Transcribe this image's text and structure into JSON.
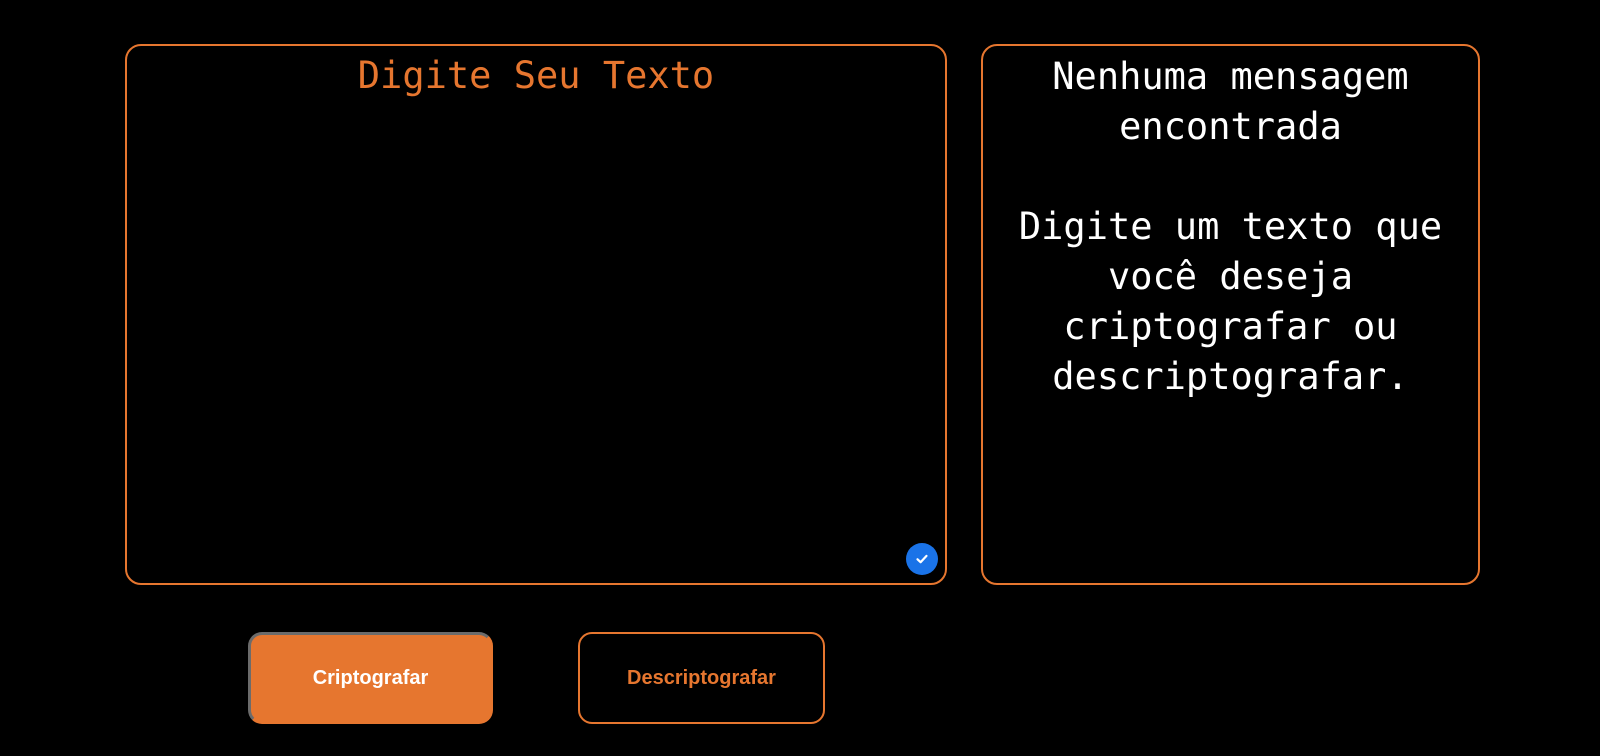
{
  "input": {
    "placeholder": "Digite Seu Texto",
    "value": ""
  },
  "output": {
    "title": "Nenhuma mensagem encontrada",
    "message": "Digite um texto que você deseja criptografar ou descriptografar."
  },
  "buttons": {
    "encrypt_label": "Criptografar",
    "decrypt_label": "Descriptografar"
  },
  "icons": {
    "grammar_badge": "check-icon"
  },
  "colors": {
    "accent": "#e6762f",
    "background": "#000000",
    "badge": "#1a73e8",
    "text": "#ffffff"
  }
}
